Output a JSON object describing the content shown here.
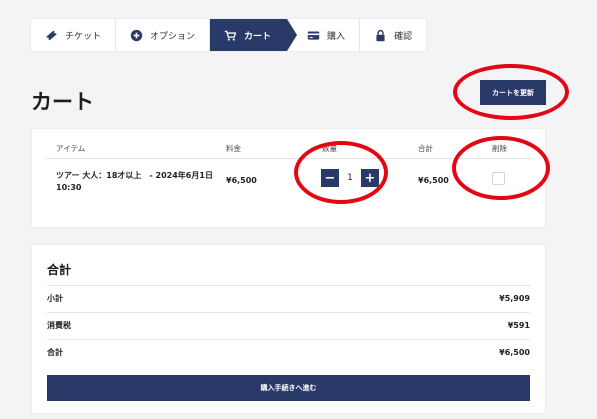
{
  "steps": [
    {
      "label": "チケット",
      "icon": "ticket-icon"
    },
    {
      "label": "オプション",
      "icon": "plus-circle-icon"
    },
    {
      "label": "カート",
      "icon": "cart-icon"
    },
    {
      "label": "購入",
      "icon": "credit-card-icon"
    },
    {
      "label": "確認",
      "icon": "lock-icon"
    }
  ],
  "page_title": "カート",
  "update_button": "カートを更新",
  "cart": {
    "headers": {
      "item": "アイテム",
      "price": "料金",
      "quantity": "数量",
      "total": "合計",
      "remove": "削除"
    },
    "row": {
      "name": "ツアー 大人：18才以上　- 2024年6月1日 10:30",
      "price": "¥6,500",
      "quantity": "1",
      "total": "¥6,500"
    },
    "minus": "−",
    "plus": "+"
  },
  "totals": {
    "title": "合計",
    "rows": [
      {
        "label": "小計",
        "value": "¥5,909"
      },
      {
        "label": "消費税",
        "value": "¥591"
      },
      {
        "label": "合計",
        "value": "¥6,500"
      }
    ],
    "checkout_button": "購入手続きへ進む"
  },
  "colors": {
    "accent": "#2a3a68",
    "annotation": "#e30613"
  }
}
